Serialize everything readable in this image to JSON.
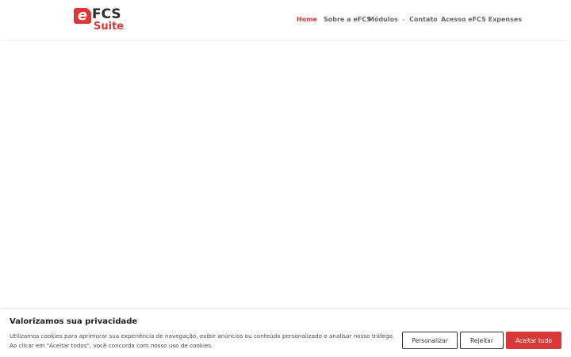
{
  "logo": {
    "mark": "e",
    "line1": "FCS",
    "line2": "Suite"
  },
  "nav": {
    "items": [
      {
        "label": "Home",
        "active": true
      },
      {
        "label": "Sobre a eFCS",
        "active": false
      },
      {
        "label": "Módulos",
        "active": false,
        "has_dropdown": true,
        "dropdown_icon": "chevron-down-icon"
      },
      {
        "label": "Contato",
        "active": false
      },
      {
        "label": "Acesso eFCS Expenses",
        "active": false
      }
    ]
  },
  "cookie_banner": {
    "title": "Valorizamos sua privacidade",
    "text": "Utilizamos cookies para aprimorar sua experiência de navegação, exibir anúncios ou conteúdo personalizado e analisar nosso tráfego. Ao clicar em \"Aceitar todos\", você concorda com nosso uso de cookies.",
    "buttons": {
      "customize": "Personalizar",
      "reject": "Rejeitar",
      "accept_all": "Aceitar tudo"
    }
  },
  "colors": {
    "accent": "#d93838",
    "nav_text": "#666666",
    "dark_text": "#212121"
  }
}
